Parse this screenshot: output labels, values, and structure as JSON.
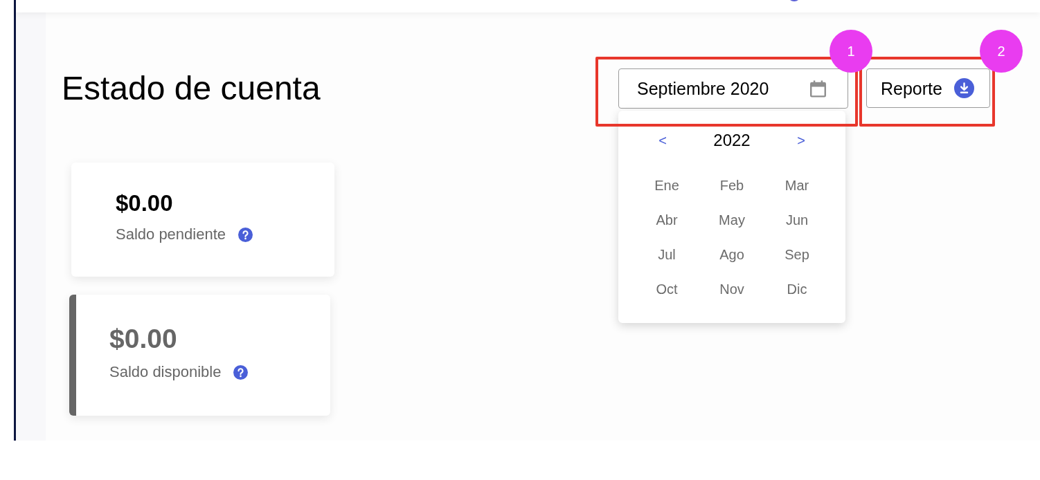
{
  "page": {
    "title": "Estado de cuenta"
  },
  "date_picker": {
    "value": "Septiembre 2020",
    "expanded": true,
    "year": "2022",
    "prev_label": "<",
    "next_label": ">",
    "months": [
      "Ene",
      "Feb",
      "Mar",
      "Abr",
      "May",
      "Jun",
      "Jul",
      "Ago",
      "Sep",
      "Oct",
      "Nov",
      "Dic"
    ]
  },
  "report_button": {
    "label": "Reporte"
  },
  "balance_cards": [
    {
      "amount": "$0.00",
      "label": "Saldo pendiente",
      "selected": false
    },
    {
      "amount": "$0.00",
      "label": "Saldo disponible",
      "selected": true
    }
  ],
  "annotations": [
    {
      "label": "1"
    },
    {
      "label": "2"
    }
  ]
}
